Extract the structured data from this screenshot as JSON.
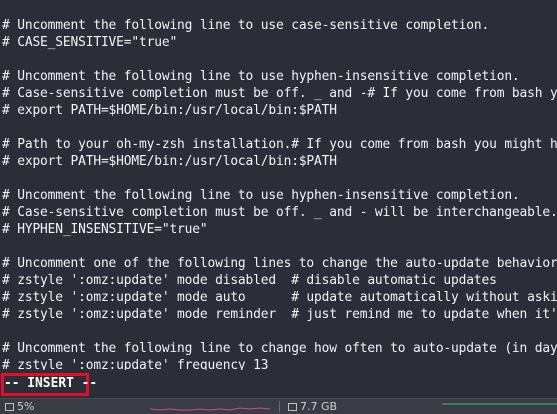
{
  "editor": {
    "lines": [
      "# Uncomment the following line to use case-sensitive completion.",
      "# CASE_SENSITIVE=\"true\"",
      "",
      "# Uncomment the following line to use hyphen-insensitive completion.",
      "# Case-sensitive completion must be off. _ and -# If you come from bash you mig",
      "# export PATH=$HOME/bin:/usr/local/bin:$PATH",
      "",
      "# Path to your oh-my-zsh installation.# If you come from bash you might have to",
      "# export PATH=$HOME/bin:/usr/local/bin:$PATH",
      "",
      "# Uncomment the following line to use hyphen-insensitive completion.",
      "# Case-sensitive completion must be off. _ and - will be interchangeable.",
      "# HYPHEN_INSENSITIVE=\"true\"",
      "",
      "# Uncomment one of the following lines to change the auto-update behavior",
      "# zstyle ':omz:update' mode disabled  # disable automatic updates",
      "# zstyle ':omz:update' mode auto      # update automatically without asking",
      "# zstyle ':omz:update' mode reminder  # just remind me to update when it's time",
      "",
      "# Uncomment the following line to change how often to auto-update (in days).",
      "# zstyle ':omz:update' frequency 13"
    ],
    "mode_label": "-- INSERT --"
  },
  "statusbar": {
    "cpu_label": "5%",
    "memory_label": "7.7 GB",
    "cpu_icon": "cpu-chip-icon",
    "memory_icon": "memory-icon",
    "colors": {
      "cpu_graph": "#d0507a",
      "memory_graph": "#3fbf6a"
    }
  },
  "colors": {
    "background": "#2b2d38",
    "text": "#f4f4f4",
    "highlight_box": "#e0102a"
  }
}
